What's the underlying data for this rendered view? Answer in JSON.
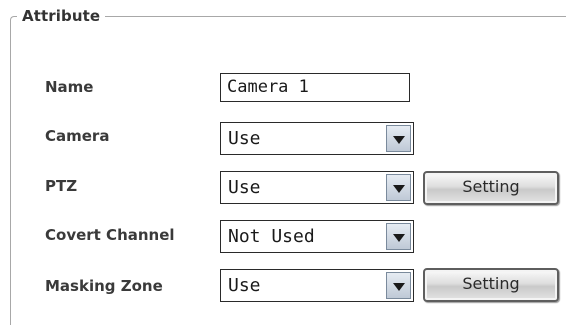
{
  "group": {
    "legend": "Attribute"
  },
  "fields": {
    "name": {
      "label": "Name",
      "value": "Camera 1"
    },
    "camera": {
      "label": "Camera",
      "selected": "Use"
    },
    "ptz": {
      "label": "PTZ",
      "selected": "Use",
      "button_label": "Setting"
    },
    "covert_channel": {
      "label": "Covert Channel",
      "selected": "Not Used"
    },
    "masking_zone": {
      "label": "Masking Zone",
      "selected": "Use",
      "button_label": "Setting"
    }
  },
  "icons": {
    "dropdown": "chevron-down-icon"
  }
}
